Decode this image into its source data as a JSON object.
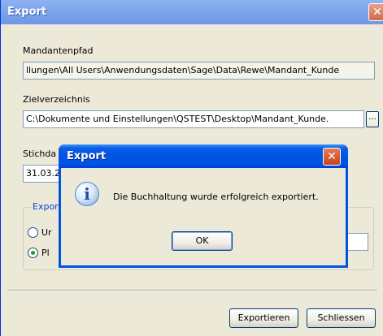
{
  "window": {
    "title": "Export",
    "close_glyph": "✕"
  },
  "mandantenpfad": {
    "label": "Mandantenpfad",
    "value": "llungen\\All Users\\Anwendungsdaten\\Sage\\Data\\Rewe\\Mandant_Kunde"
  },
  "zielverzeichnis": {
    "label": "Zielverzeichnis",
    "value": "C:\\Dokumente und Einstellungen\\QSTEST\\Desktop\\Mandant_Kunde.",
    "browse_label": "..."
  },
  "stichdatum": {
    "label": "Stichda",
    "value": "31.03.2"
  },
  "export_group": {
    "legend": "Expor",
    "options": [
      {
        "label": "Ur",
        "checked": false
      },
      {
        "label": "Pl",
        "checked": true
      }
    ]
  },
  "buttons": {
    "export": "Exportieren",
    "close": "Schliessen"
  },
  "dialog": {
    "title": "Export",
    "close_glyph": "✕",
    "icon": "info-icon",
    "icon_glyph": "i",
    "message": "Die Buchhaltung wurde erfolgreich exportiert.",
    "ok_label": "OK"
  }
}
